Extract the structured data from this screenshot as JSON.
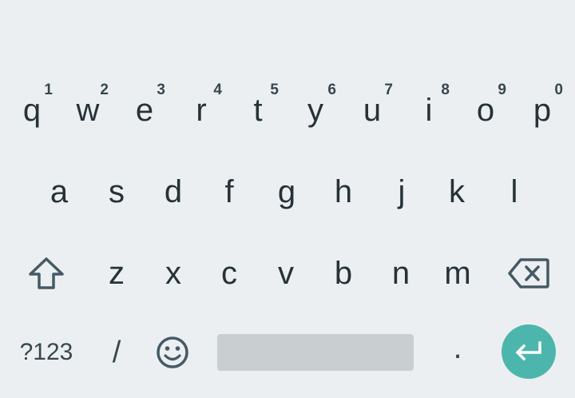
{
  "keyboard": {
    "row1": [
      {
        "letter": "q",
        "hint": "1"
      },
      {
        "letter": "w",
        "hint": "2"
      },
      {
        "letter": "e",
        "hint": "3"
      },
      {
        "letter": "r",
        "hint": "4"
      },
      {
        "letter": "t",
        "hint": "5"
      },
      {
        "letter": "y",
        "hint": "6"
      },
      {
        "letter": "u",
        "hint": "7"
      },
      {
        "letter": "i",
        "hint": "8"
      },
      {
        "letter": "o",
        "hint": "9"
      },
      {
        "letter": "p",
        "hint": "0"
      }
    ],
    "row2": [
      {
        "letter": "a"
      },
      {
        "letter": "s"
      },
      {
        "letter": "d"
      },
      {
        "letter": "f"
      },
      {
        "letter": "g"
      },
      {
        "letter": "h"
      },
      {
        "letter": "j"
      },
      {
        "letter": "k"
      },
      {
        "letter": "l"
      }
    ],
    "row3": [
      {
        "letter": "z"
      },
      {
        "letter": "x"
      },
      {
        "letter": "c"
      },
      {
        "letter": "v"
      },
      {
        "letter": "b"
      },
      {
        "letter": "n"
      },
      {
        "letter": "m"
      }
    ],
    "row4": {
      "symbols_label": "?123",
      "slash_label": "/",
      "period_label": "."
    },
    "icons": {
      "shift": "shift-icon",
      "backspace": "backspace-icon",
      "emoji": "emoji-icon",
      "enter": "enter-icon"
    },
    "colors": {
      "background": "#eceff1",
      "key_text": "#263238",
      "space_bar": "#c9ced1",
      "enter_accent": "#4db6ac"
    }
  }
}
